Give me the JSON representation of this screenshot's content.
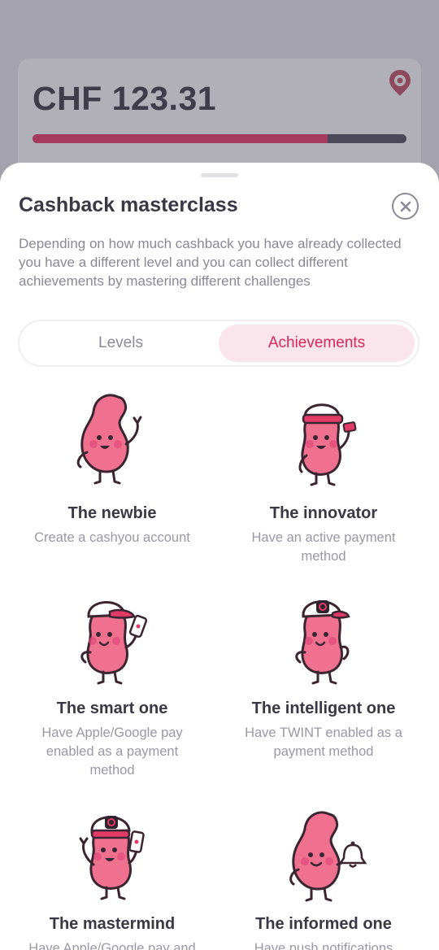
{
  "background": {
    "amount": "CHF 123.31",
    "progress_fraction": 0.79
  },
  "sheet": {
    "title": "Cashback masterclass",
    "description": "Depending on how much cashback you have already collected you have a different level and you can collect different achievements by mastering different challenges",
    "tabs": [
      {
        "label": "Levels",
        "active": false
      },
      {
        "label": "Achievements",
        "active": true
      }
    ],
    "achievements": [
      {
        "name": "The newbie",
        "description": "Create a cashyou account",
        "icon": "bean-waving-icon"
      },
      {
        "name": "The innovator",
        "description": "Have an active payment method",
        "icon": "bean-cap-card-icon"
      },
      {
        "name": "The smart one",
        "description": "Have Apple/Google pay enabled as a payment method",
        "icon": "bean-cap-phone-icon"
      },
      {
        "name": "The intelligent one",
        "description": "Have TWINT enabled as a payment method",
        "icon": "bean-cap-logo-icon"
      },
      {
        "name": "The mastermind",
        "description": "Have Apple/Google pay and",
        "icon": "bean-cap-logo-phone-icon"
      },
      {
        "name": "The informed one",
        "description": "Have push notifications",
        "icon": "bean-bell-icon"
      }
    ]
  },
  "colors": {
    "accent": "#d8285a",
    "accent_light": "#fbe5ec",
    "bean": "#f0708f",
    "outline": "#3a2530"
  }
}
